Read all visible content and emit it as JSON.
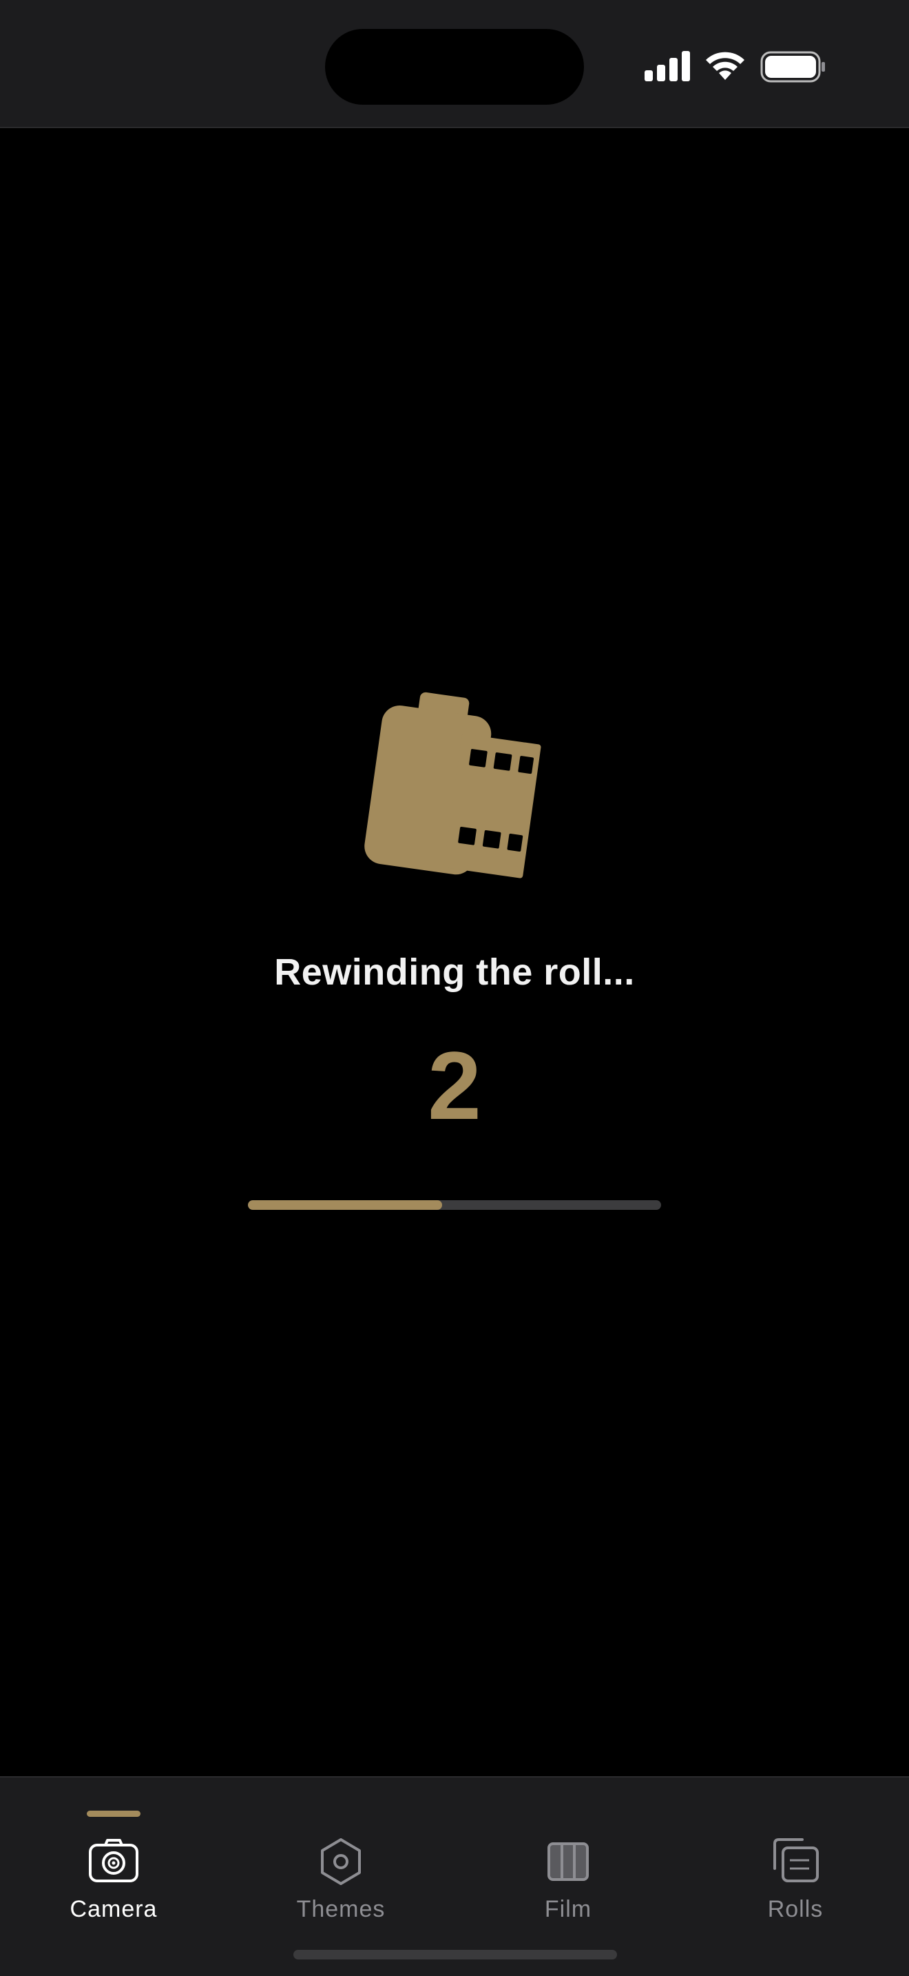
{
  "status": {
    "message": "Rewinding the roll...",
    "countdown": "2",
    "progress": 0.47
  },
  "tabs": [
    {
      "label": "Camera",
      "icon": "camera-icon",
      "active": true
    },
    {
      "label": "Themes",
      "icon": "hexagon-icon",
      "active": false
    },
    {
      "label": "Film",
      "icon": "film-icon",
      "active": false
    },
    {
      "label": "Rolls",
      "icon": "rolls-icon",
      "active": false
    }
  ],
  "colors": {
    "accent": "#a38b5c",
    "background": "#000000",
    "bar_background": "#1c1c1e"
  }
}
